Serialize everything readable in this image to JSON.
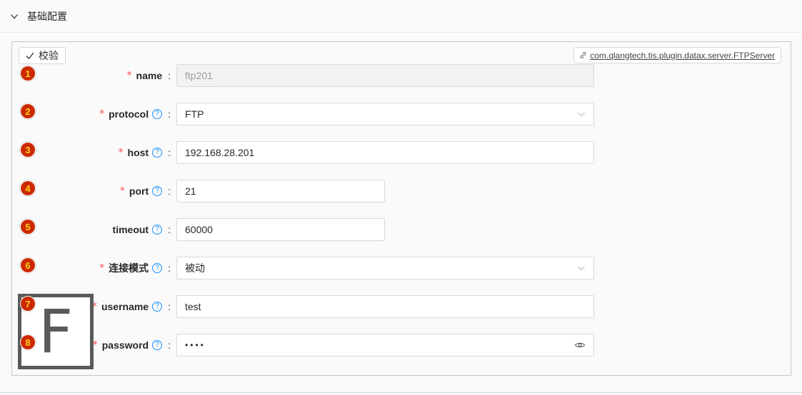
{
  "section": {
    "title": "基础配置",
    "chevron_icon": "chevron-down-icon"
  },
  "toolbar": {
    "validate_label": "校验",
    "plugin_link": "com.qlangtech.tis.plugin.datax.server.FTPServer"
  },
  "logo": {
    "letter": "F"
  },
  "form": {
    "fields": [
      {
        "index": "1",
        "label": "name",
        "required": "*",
        "help": "",
        "value": "ftp201"
      },
      {
        "index": "2",
        "label": "protocol",
        "required": "*",
        "help": "?",
        "value": "FTP"
      },
      {
        "index": "3",
        "label": "host",
        "required": "*",
        "help": "?",
        "value": "192.168.28.201"
      },
      {
        "index": "4",
        "label": "port",
        "required": "*",
        "help": "?",
        "value": "21"
      },
      {
        "index": "5",
        "label": "timeout",
        "required": "",
        "help": "?",
        "value": "60000"
      },
      {
        "index": "6",
        "label": "连接模式",
        "required": "*",
        "help": "?",
        "value": "被动"
      },
      {
        "index": "7",
        "label": "username",
        "required": "*",
        "help": "?",
        "value": "test"
      },
      {
        "index": "8",
        "label": "password",
        "required": "*",
        "help": "?",
        "value": "••••"
      }
    ],
    "colon": ":"
  },
  "colors": {
    "badge_bg": "#cc2900",
    "badge_text": "#ffd21a",
    "required": "#ff4d4f",
    "help": "#1890ff"
  }
}
